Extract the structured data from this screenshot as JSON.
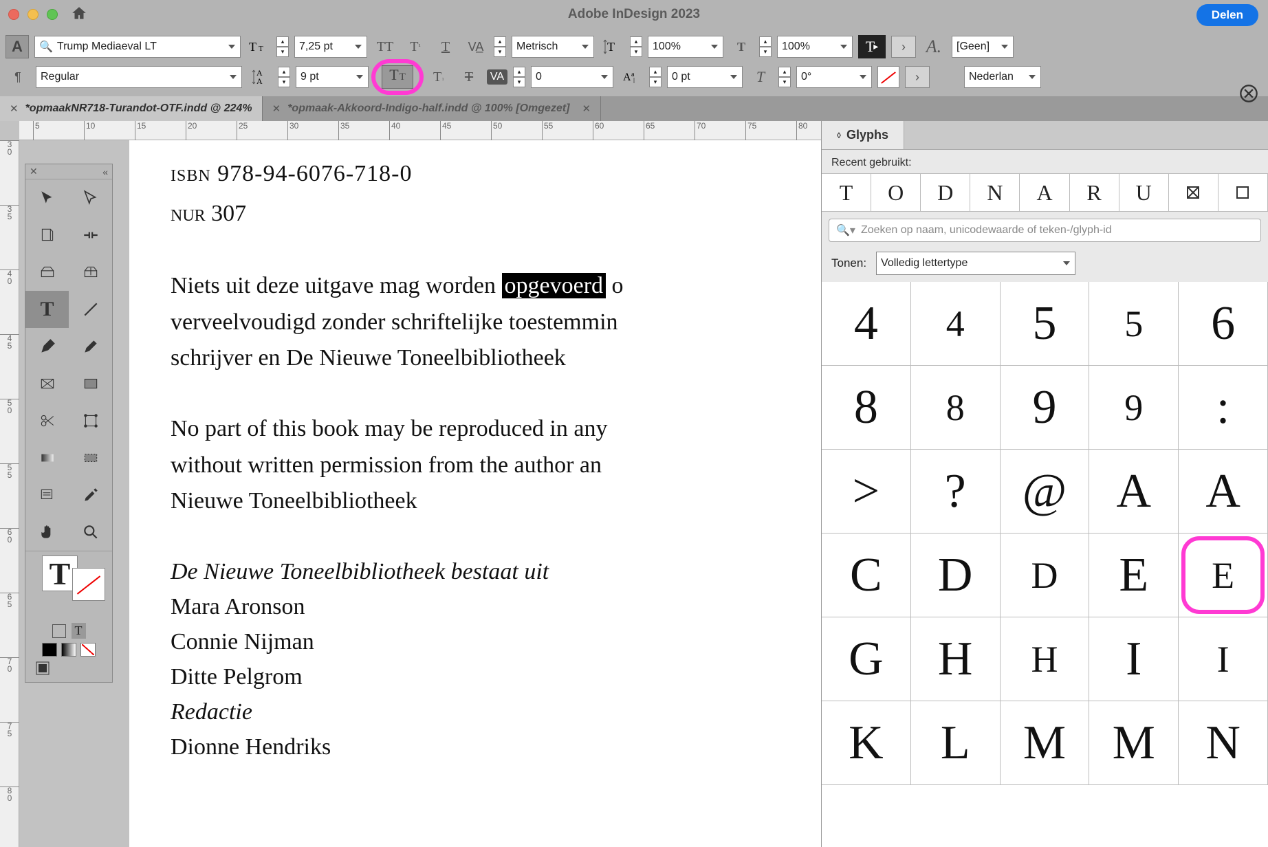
{
  "app": {
    "title": "Adobe InDesign 2023",
    "share_label": "Delen"
  },
  "control_panel": {
    "font_family": "Trump Mediaeval LT",
    "font_style": "Regular",
    "font_size": "7,25 pt",
    "leading": "9 pt",
    "kerning_method": "Metrisch",
    "tracking": "0",
    "horiz_scale": "100%",
    "vert_scale": "100%",
    "baseline_shift": "0 pt",
    "skew": "0°",
    "char_style": "[Geen]",
    "language": "Nederlan"
  },
  "document_tabs": [
    {
      "name": "*opmaakNR718-Turandot-OTF.indd @ 224%",
      "active": true
    },
    {
      "name": "*opmaak-Akkoord-Indigo-half.indd @ 100% [Omgezet]",
      "active": false
    }
  ],
  "rulers": {
    "horizontal": [
      "5",
      "10",
      "15",
      "20",
      "25",
      "30",
      "35",
      "40",
      "45",
      "50",
      "55",
      "60",
      "65",
      "70",
      "75",
      "80"
    ],
    "vertical": [
      "30",
      "35",
      "40",
      "45",
      "50",
      "55",
      "60",
      "65",
      "70",
      "75",
      "80"
    ]
  },
  "document": {
    "isbn": "isbn 978-94-6076-718-0",
    "nur": "nur 307",
    "para_nl_pre": "Niets uit deze uitgave mag worden ",
    "para_nl_highlight": "opgevoerd",
    "para_nl_post": " o",
    "para_nl_line2": "verveelvoudigd zonder schriftelijke toestemmin",
    "para_nl_line3": "schrijver en De Nieuwe Toneelbibliotheek",
    "para_en_line1": "No part of this book may be reproduced in any",
    "para_en_line2": "without written permission from the author an",
    "para_en_line3": "Nieuwe Toneelbibliotheek",
    "credits_title": "De Nieuwe Toneelbibliotheek bestaat uit",
    "names": [
      "Mara Aronson",
      "Connie Nijman",
      "Ditte Pelgrom"
    ],
    "redactie_label": "Redactie",
    "redactie_names": [
      "Dionne Hendriks"
    ]
  },
  "glyphs_panel": {
    "tab_label": "Glyphs",
    "recent_label": "Recent gebruikt:",
    "recent": [
      "T",
      "O",
      "D",
      "N",
      "A",
      "R",
      "U"
    ],
    "search_placeholder": "Zoeken op naam, unicodewaarde of teken-/glyph-id",
    "show_label": "Tonen:",
    "show_value": "Volledig lettertype",
    "grid": [
      [
        "4",
        "4",
        "5",
        "5",
        "6"
      ],
      [
        "8",
        "8",
        "9",
        "9",
        ":"
      ],
      [
        ">",
        "?",
        "@",
        "A",
        "A"
      ],
      [
        "C",
        "D",
        "D",
        "E",
        "E"
      ],
      [
        "G",
        "H",
        "H",
        "I",
        "I"
      ],
      [
        "K",
        "L",
        "M",
        "M",
        "N"
      ]
    ],
    "smallcap_cols": [
      1,
      3,
      4
    ],
    "smallcap_map": {
      "0": [
        1,
        3
      ],
      "1": [
        1,
        3
      ],
      "2": [],
      "3": [
        2,
        4
      ],
      "4": [
        2,
        4
      ],
      "5": []
    }
  },
  "annotations": {
    "pink_circle_control": "small-caps-toggle",
    "pink_circle_glyph": {
      "row": 3,
      "col": 4
    }
  }
}
